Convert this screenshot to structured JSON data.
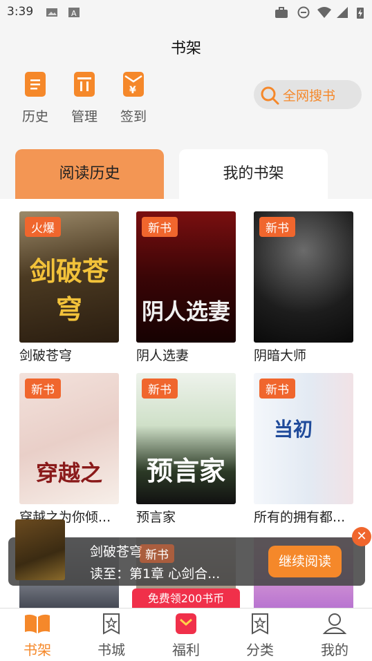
{
  "status_bar": {
    "time": "3:39"
  },
  "header": {
    "title": "书架"
  },
  "quick_actions": [
    {
      "label": "历史",
      "icon": "document-icon"
    },
    {
      "label": "管理",
      "icon": "trash-icon"
    },
    {
      "label": "签到",
      "icon": "yen-envelope-icon"
    }
  ],
  "search": {
    "label": "全网搜书"
  },
  "tabs": [
    {
      "label": "阅读历史",
      "active": true
    },
    {
      "label": "我的书架",
      "active": false
    }
  ],
  "books": [
    {
      "name": "剑破苍穹",
      "tag": "火爆",
      "cover_text": "剑破苍穹"
    },
    {
      "name": "阴人选妻",
      "tag": "新书",
      "cover_text": "阴人选妻"
    },
    {
      "name": "阴暗大师",
      "tag": "新书",
      "cover_text": ""
    },
    {
      "name": "穿越之为你倾...",
      "tag": "新书",
      "cover_text": "穿越之"
    },
    {
      "name": "预言家",
      "tag": "新书",
      "cover_text": "预言家"
    },
    {
      "name": "所有的拥有都...",
      "tag": "新书",
      "cover_text": "当初"
    }
  ],
  "continue_reading": {
    "title": "剑破苍穹",
    "progress": "读至：第1章 心剑合...",
    "button": "继续阅读",
    "close": "✕",
    "hidden_tag": "新书"
  },
  "promo": {
    "label": "免费领200书币"
  },
  "bottom_nav": [
    {
      "label": "书架",
      "icon": "book-open-icon",
      "active": true
    },
    {
      "label": "书城",
      "icon": "bookstore-icon",
      "active": false
    },
    {
      "label": "福利",
      "icon": "gift-icon",
      "active": false
    },
    {
      "label": "分类",
      "icon": "category-icon",
      "active": false
    },
    {
      "label": "我的",
      "icon": "profile-icon",
      "active": false
    }
  ]
}
